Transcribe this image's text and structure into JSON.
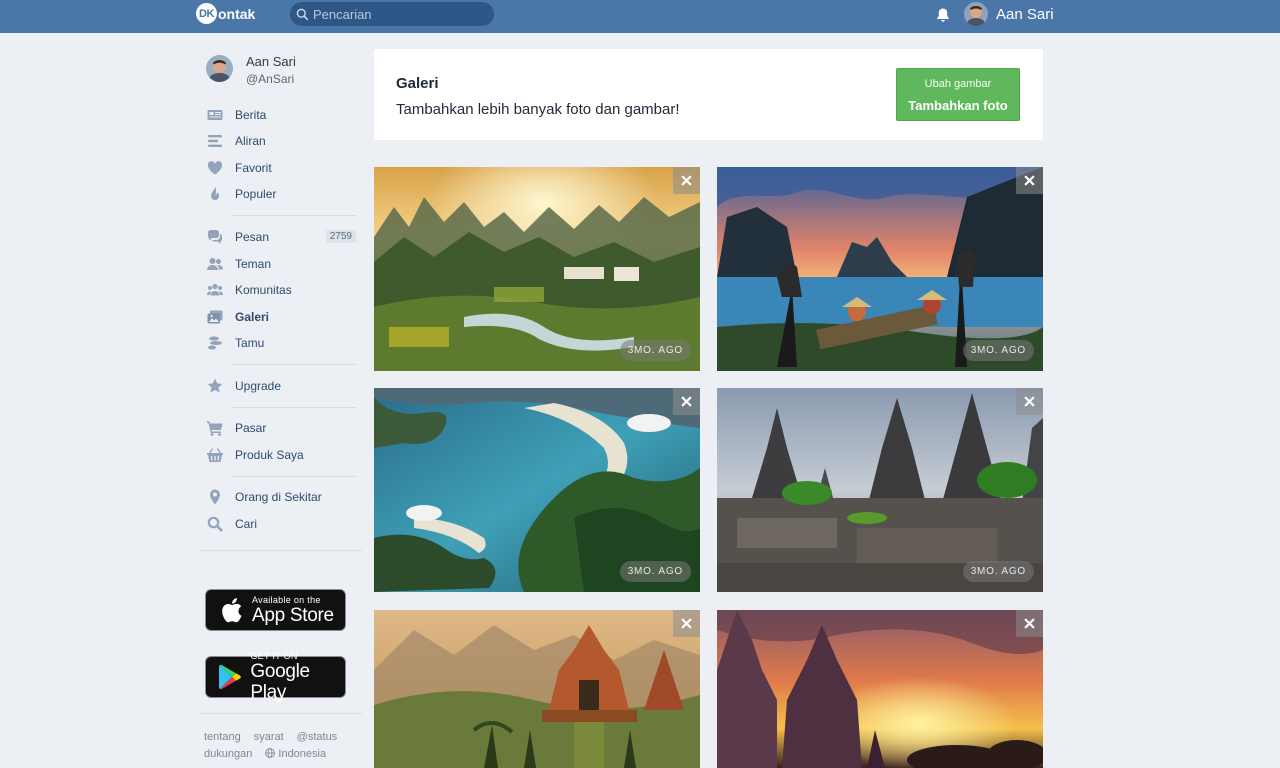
{
  "topbar": {
    "logo_badge": "DK",
    "logo_text": "ontak",
    "search_placeholder": "Pencarian",
    "user_name": "Aan Sari"
  },
  "profile": {
    "name": "Aan Sari",
    "handle": "@AnSari"
  },
  "nav": [
    {
      "label": "Berita",
      "icon": "newspaper-icon"
    },
    {
      "label": "Aliran",
      "icon": "stream-icon"
    },
    {
      "label": "Favorit",
      "icon": "heart-icon"
    },
    {
      "label": "Populer",
      "icon": "flame-icon"
    },
    {
      "label": "Pesan",
      "icon": "chat-icon",
      "badge": "2759"
    },
    {
      "label": "Teman",
      "icon": "friends-icon"
    },
    {
      "label": "Komunitas",
      "icon": "community-icon"
    },
    {
      "label": "Galeri",
      "icon": "gallery-icon",
      "active": true
    },
    {
      "label": "Tamu",
      "icon": "guests-icon"
    },
    {
      "label": "Upgrade",
      "icon": "star-icon"
    },
    {
      "label": "Pasar",
      "icon": "cart-icon"
    },
    {
      "label": "Produk Saya",
      "icon": "basket-icon"
    },
    {
      "label": "Orang di Sekitar",
      "icon": "location-pin-icon"
    },
    {
      "label": "Cari",
      "icon": "search-icon"
    }
  ],
  "stores": {
    "apple_small": "Available on the",
    "apple_big": "App Store",
    "google_small": "GET IT ON",
    "google_big": "Google Play"
  },
  "footer": {
    "links": [
      "tentang",
      "syarat",
      "@status",
      "dukungan"
    ],
    "language": "Indonesia"
  },
  "gallery": {
    "title": "Galeri",
    "subtitle": "Tambahkan lebih banyak foto dan gambar!",
    "button_small": "Ubah gambar",
    "button_big": "Tambahkan foto",
    "photos": [
      {
        "time": "3MO. AGO",
        "scene": "valley-sunrise"
      },
      {
        "time": "3MO. AGO",
        "scene": "river-fishermen"
      },
      {
        "time": "3MO. AGO",
        "scene": "island-bay"
      },
      {
        "time": "3MO. AGO",
        "scene": "temple-ruins"
      },
      {
        "time": "",
        "scene": "painted-gate"
      },
      {
        "time": "",
        "scene": "temple-sunset"
      }
    ]
  },
  "colors": {
    "topbar": "#4a76a8",
    "accent_green": "#5fb85c",
    "background": "#eceff3"
  }
}
